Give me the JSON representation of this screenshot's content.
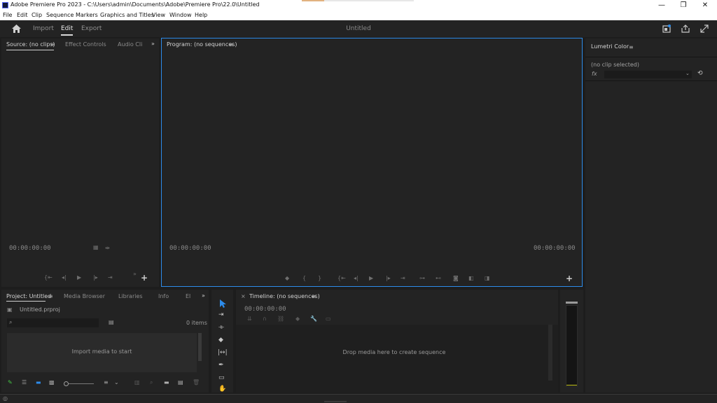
{
  "window": {
    "title": "Adobe Premiere Pro 2023 - C:\\Users\\admin\\Documents\\Adobe\\Premiere Pro\\22.0\\Untitled",
    "minimize": "—",
    "maximize": "❐",
    "close": "✕"
  },
  "menu": [
    "File",
    "Edit",
    "Clip",
    "Sequence",
    "Markers",
    "Graphics and Titles",
    "View",
    "Window",
    "Help"
  ],
  "header": {
    "workspaces": [
      "Import",
      "Edit",
      "Export"
    ],
    "active_workspace": "Edit",
    "project_title": "Untitled"
  },
  "source_panel": {
    "tabs": [
      "Source: (no clips)",
      "Effect Controls",
      "Audio Cli"
    ],
    "timecode": "00:00:00:00"
  },
  "program_panel": {
    "title": "Program: (no sequences)",
    "timecode_left": "00:00:00:00",
    "timecode_right": "00:00:00:00"
  },
  "lumetri_panel": {
    "title": "Lumetri Color",
    "clip_status": "(no clip selected)",
    "fx_label": "fx"
  },
  "project_panel": {
    "tabs": [
      "Project: Untitled",
      "Media Browser",
      "Libraries",
      "Info",
      "El"
    ],
    "file_name": "Untitled.prproj",
    "item_count": "0 items",
    "empty_message": "Import media to start",
    "search_placeholder": ""
  },
  "timeline_panel": {
    "title": "Timeline: (no sequences)",
    "timecode": "00:00:00:00",
    "drop_message": "Drop media here to create sequence"
  },
  "colors": {
    "accent_blue": "#2d8ceb",
    "panel_bg": "#232323",
    "app_bg": "#1d1d1d",
    "meter_level": "#c8c81e"
  }
}
